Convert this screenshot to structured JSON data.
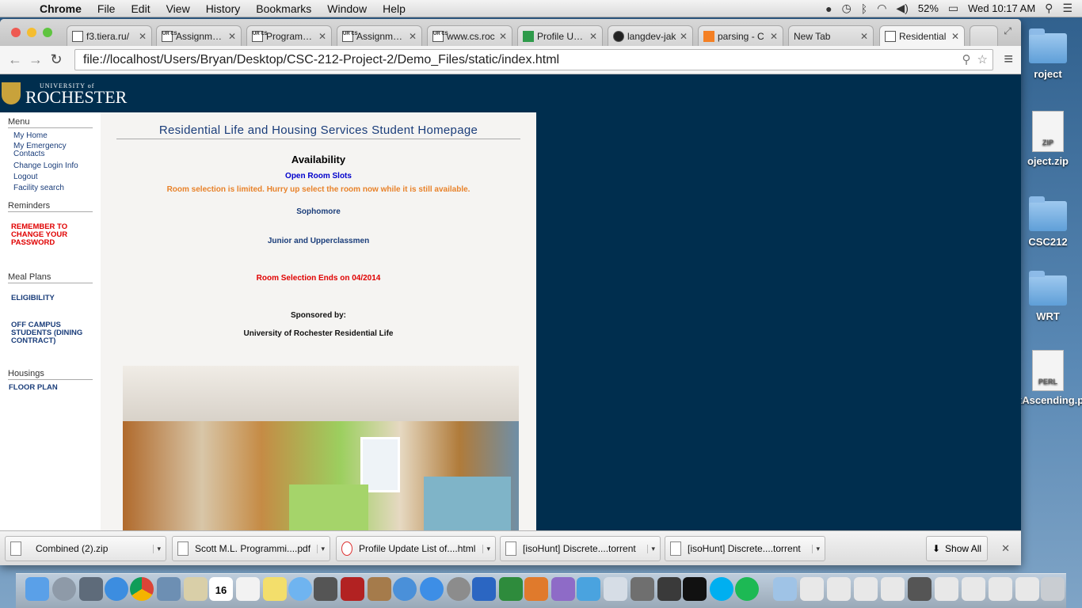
{
  "menubar": {
    "app": "Chrome",
    "items": [
      "File",
      "Edit",
      "View",
      "History",
      "Bookmarks",
      "Window",
      "Help"
    ],
    "battery": "52%",
    "clock": "Wed 10:17 AM"
  },
  "desktop": {
    "icons": [
      {
        "label": "roject"
      },
      {
        "label": "oject.zip",
        "tag": "ZIP"
      },
      {
        "label": "CSC212"
      },
      {
        "label": "WRT"
      },
      {
        "label": "xAscending.pl",
        "tag": "PERL"
      }
    ]
  },
  "tabs": [
    {
      "label": "f3.tiera.ru/",
      "fav": ""
    },
    {
      "label": "Assignment",
      "fav": "UR CS"
    },
    {
      "label": "Programmin",
      "fav": "UR CS"
    },
    {
      "label": "Assignment",
      "fav": "UR CS"
    },
    {
      "label": "www.cs.roc",
      "fav": "UR CS"
    },
    {
      "label": "Profile Upda",
      "fav": ""
    },
    {
      "label": "langdev-jak",
      "fav": ""
    },
    {
      "label": "parsing - C",
      "fav": ""
    },
    {
      "label": "New Tab",
      "fav": ""
    },
    {
      "label": "Residential",
      "fav": ""
    }
  ],
  "address": "file://localhost/Users/Bryan/Desktop/CSC-212-Project-2/Demo_Files/static/index.html",
  "logo": {
    "small": "UNIVERSITY of",
    "big": "ROCHESTER"
  },
  "sidebar": {
    "menu_title": "Menu",
    "menu_items": [
      "My Home",
      "My Emergency Contacts",
      "Change Login Info",
      "Logout",
      "Facility search"
    ],
    "reminders_title": "Reminders",
    "reminder": "REMEMBER TO CHANGE YOUR PASSWORD",
    "meal_title": "Meal Plans",
    "meal_items": [
      "ELIGIBILITY",
      "OFF CAMPUS STUDENTS (DINING CONTRACT)"
    ],
    "housing_title": "Housings",
    "housing_items": [
      "FLOOR PLAN"
    ]
  },
  "content": {
    "title": "Residential Life and Housing Services Student Homepage",
    "heading": "Availability",
    "open_slots": "Open Room Slots",
    "warning": "Room selection is limited. Hurry up select the room now while it is still available.",
    "sophomore": "Sophomore",
    "upperclass": "Junior and Upperclassmen",
    "ends": "Room Selection Ends on 04/2014",
    "sponsored": "Sponsored by:",
    "sponsor": "University of Rochester Residential Life"
  },
  "downloads": [
    {
      "name": "Combined (2).zip"
    },
    {
      "name": "Scott M.L. Programmi....pdf"
    },
    {
      "name": "Profile Update List of....html"
    },
    {
      "name": "[isoHunt] Discrete....torrent"
    },
    {
      "name": "[isoHunt] Discrete....torrent"
    }
  ],
  "show_all": "Show All",
  "dock_calendar": "16",
  "colors": {
    "page_bg": "#002e4e",
    "link": "#1a3d7a",
    "warning": "#e8822a",
    "alert": "#e00000",
    "slots": "#0000cc"
  }
}
